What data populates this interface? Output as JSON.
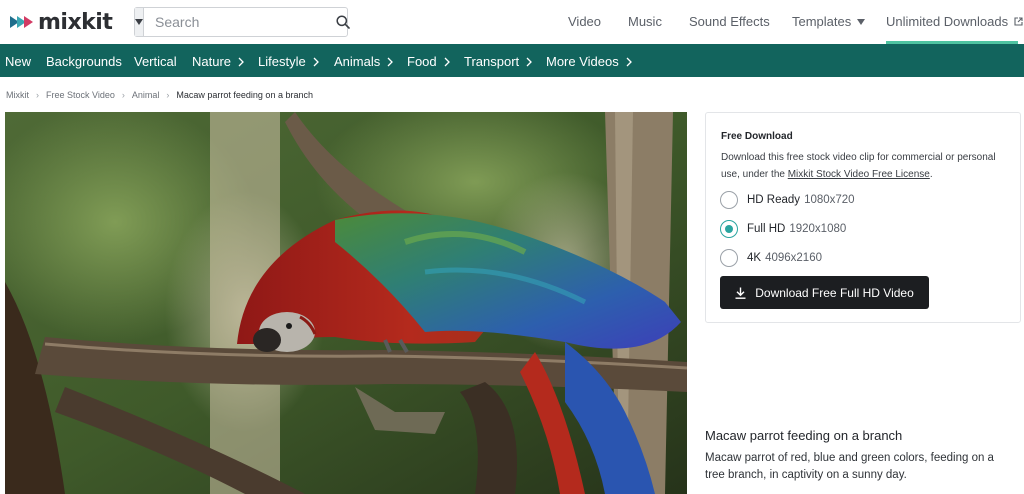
{
  "brand": {
    "name": "mixkit",
    "accent": "#12645d",
    "highlight": "#4fc3a1"
  },
  "search": {
    "placeholder": "Search",
    "type_icon": "caret-down-icon",
    "button_icon": "search-icon"
  },
  "top_nav": {
    "items": [
      {
        "label": "Video"
      },
      {
        "label": "Music"
      },
      {
        "label": "Sound Effects"
      },
      {
        "label": "Templates",
        "icon": "caret-down-icon"
      },
      {
        "label": "Unlimited Downloads",
        "icon": "external-link-icon"
      }
    ]
  },
  "categories": {
    "items": [
      {
        "label": "New"
      },
      {
        "label": "Backgrounds"
      },
      {
        "label": "Vertical"
      },
      {
        "label": "Nature",
        "icon": "chevron-right-icon"
      },
      {
        "label": "Lifestyle",
        "icon": "chevron-right-icon"
      },
      {
        "label": "Animals",
        "icon": "chevron-right-icon"
      },
      {
        "label": "Food",
        "icon": "chevron-right-icon"
      },
      {
        "label": "Transport",
        "icon": "chevron-right-icon"
      },
      {
        "label": "More Videos",
        "icon": "chevron-right-icon"
      }
    ]
  },
  "breadcrumb": {
    "items": [
      "Mixkit",
      "Free Stock Video",
      "Animal"
    ],
    "current": "Macaw parrot feeding on a branch"
  },
  "download": {
    "title": "Free Download",
    "desc_prefix": "Download this free stock video clip for commercial or personal use, under the ",
    "license_link": "Mixkit Stock Video Free License",
    "desc_suffix": ".",
    "options": [
      {
        "name": "HD Ready",
        "resolution": "1080x720",
        "selected": false
      },
      {
        "name": "Full HD",
        "resolution": "1920x1080",
        "selected": true
      },
      {
        "name": "4K",
        "resolution": "4096x2160",
        "selected": false
      }
    ],
    "button_label": "Download Free Full HD Video",
    "button_icon": "download-icon"
  },
  "video": {
    "title": "Macaw parrot feeding on a branch",
    "description": "Macaw parrot of red, blue and green colors, feeding on a tree branch, in captivity on a sunny day."
  }
}
